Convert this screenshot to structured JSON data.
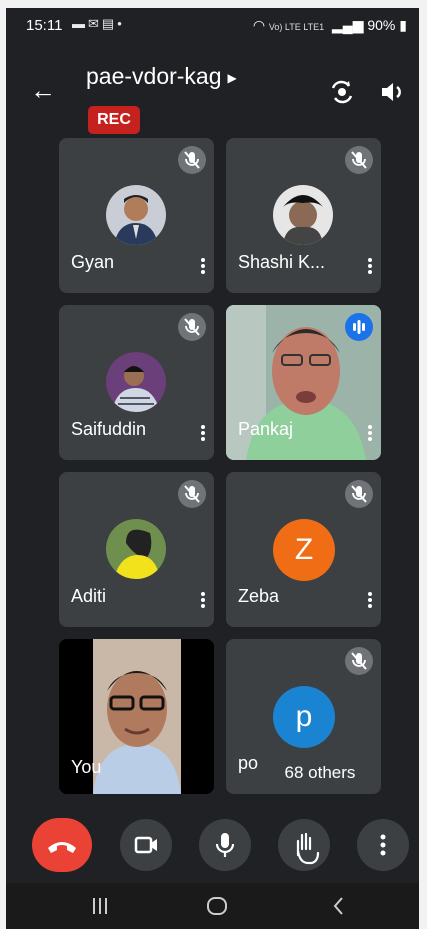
{
  "status_bar": {
    "time": "15:11",
    "notification_icons": [
      "message-icon",
      "mail-icon",
      "calendar-icon",
      "dot-icon"
    ],
    "network_label": "Vo) LTE LTE1",
    "battery": "90%"
  },
  "meeting": {
    "title": "pae-vdor-kag",
    "recording_badge": "REC"
  },
  "participants": [
    {
      "name": "Gyan",
      "muted": true,
      "kind": "photo"
    },
    {
      "name": "Shashi K...",
      "muted": true,
      "kind": "photo"
    },
    {
      "name": "Saifuddin",
      "muted": true,
      "kind": "photo"
    },
    {
      "name": "Pankaj",
      "muted": false,
      "speaking": true,
      "kind": "video"
    },
    {
      "name": "Aditi",
      "muted": true,
      "kind": "photo"
    },
    {
      "name": "Zeba",
      "muted": true,
      "kind": "letter",
      "initial": "Z",
      "color": "#f06d16"
    },
    {
      "name": "You",
      "muted": false,
      "kind": "video"
    },
    {
      "name": "po",
      "muted": true,
      "kind": "letter",
      "initial": "p",
      "color": "#1a84d3"
    }
  ],
  "others_count": "68 others",
  "colors": {
    "background": "#202124",
    "tile": "#3c4043",
    "end_call": "#ea4335",
    "rec": "#c5221f",
    "speaking": "#1a73e8"
  }
}
